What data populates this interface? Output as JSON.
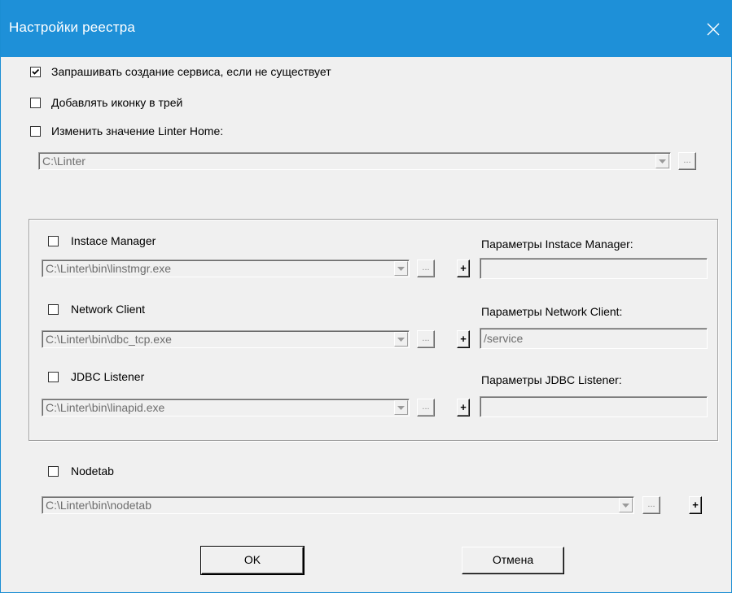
{
  "window": {
    "title": "Настройки реестра",
    "close_glyph": "✕",
    "accent": "#1e90d8"
  },
  "options": {
    "ask_create_service": {
      "label": "Запрашивать создание сервиса, если не существует",
      "checked": true
    },
    "tray_icon": {
      "label": "Добавлять иконку в трей",
      "checked": false
    },
    "change_home": {
      "label": "Изменить значение Linter Home:",
      "checked": false
    },
    "home_path": "C:\\Linter"
  },
  "services": [
    {
      "label": "Instace Manager",
      "checked": false,
      "path": "C:\\Linter\\bin\\linstmgr.exe",
      "params_label": "Параметры Instace Manager:",
      "params_value": ""
    },
    {
      "label": "Network Client",
      "checked": false,
      "path": "C:\\Linter\\bin\\dbc_tcp.exe",
      "params_label": "Параметры Network Client:",
      "params_value": "/service"
    },
    {
      "label": "JDBC Listener",
      "checked": false,
      "path": "C:\\Linter\\bin\\linapid.exe",
      "params_label": "Параметры JDBC Listener:",
      "params_value": ""
    }
  ],
  "nodetab": {
    "label": "Nodetab",
    "checked": false,
    "path": "C:\\Linter\\bin\\nodetab"
  },
  "controls": {
    "browse_label": "...",
    "plus_label": "+",
    "dropdown_icon": "chevron-down-icon"
  },
  "buttons": {
    "ok": "OK",
    "cancel": "Отмена"
  }
}
